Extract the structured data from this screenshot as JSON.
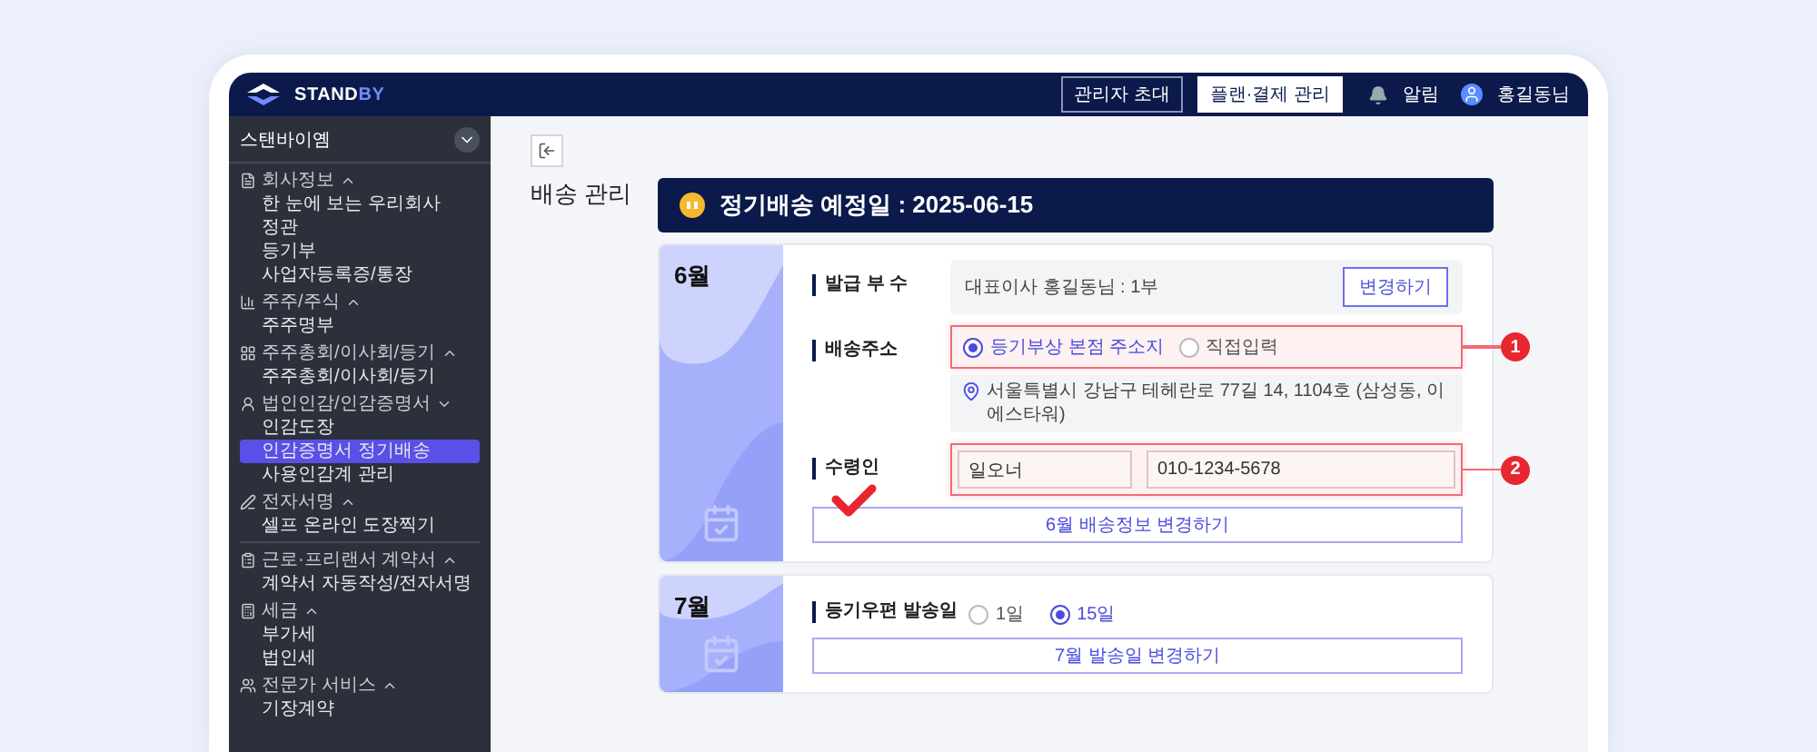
{
  "header": {
    "logo": {
      "text": "STAND",
      "accent": "BY"
    },
    "buttons": [
      {
        "label": "관리자 초대",
        "kind": "outline"
      },
      {
        "label": "플랜·결제 관리",
        "kind": "solid"
      }
    ],
    "notifications": "알림",
    "user": "홍길동님"
  },
  "sidebar": {
    "company": "스탠바이옘",
    "groups": [
      {
        "title": "회사정보",
        "expanded": true,
        "divider_before": false,
        "items": [
          {
            "label": "한 눈에 보는 우리회사",
            "selected": false
          },
          {
            "label": "정관",
            "selected": false
          },
          {
            "label": "등기부",
            "selected": false
          },
          {
            "label": "사업자등록증/통장",
            "selected": false
          }
        ]
      },
      {
        "title": "주주/주식",
        "expanded": true,
        "divider_before": false,
        "items": [
          {
            "label": "주주명부",
            "selected": false
          }
        ]
      },
      {
        "title": "주주총회/이사회/등기",
        "expanded": true,
        "divider_before": false,
        "items": [
          {
            "label": "주주총회/이사회/등기",
            "selected": false
          }
        ]
      },
      {
        "title": "법인인감/인감증명서",
        "expanded": false,
        "divider_before": false,
        "items": [
          {
            "label": "인감도장",
            "selected": false
          },
          {
            "label": "인감증명서 정기배송",
            "selected": true
          },
          {
            "label": "사용인감계 관리",
            "selected": false
          }
        ]
      },
      {
        "title": "전자서명",
        "expanded": true,
        "divider_before": false,
        "items": [
          {
            "label": "셀프 온라인 도장찍기",
            "selected": false
          }
        ]
      },
      {
        "title": "근로·프리랜서 계약서",
        "expanded": true,
        "divider_before": true,
        "items": [
          {
            "label": "계약서 자동작성/전자서명",
            "selected": false
          }
        ]
      },
      {
        "title": "세금",
        "expanded": true,
        "divider_before": false,
        "items": [
          {
            "label": "부가세",
            "selected": false
          },
          {
            "label": "법인세",
            "selected": false
          }
        ]
      },
      {
        "title": "전문가 서비스",
        "expanded": true,
        "divider_before": false,
        "items": [
          {
            "label": "기장계약",
            "selected": false
          }
        ]
      }
    ]
  },
  "page": {
    "title": "배송 관리"
  },
  "banner": {
    "text": "정기배송 예정일 : 2025-06-15"
  },
  "months": [
    {
      "kind": "full",
      "month": "6월",
      "checked": true,
      "copies": {
        "label": "발급 부 수",
        "value": "대표이사 홍길동님 : 1부",
        "button": "변경하기"
      },
      "address": {
        "label": "배송주소",
        "marker": "1",
        "options": [
          {
            "label": "등기부상 본점 주소지",
            "selected": true
          },
          {
            "label": "직접입력",
            "selected": false
          }
        ],
        "value": "서울특별시 강남구 테헤란로 77길 14, 1104호 (삼성동, 이에스타워)"
      },
      "recipient": {
        "label": "수령인",
        "marker": "2",
        "name": "일오너",
        "phone": "010-1234-5678"
      },
      "action": "6월 배송정보 변경하기"
    },
    {
      "kind": "date",
      "month": "7월",
      "checked": false,
      "label": "등기우편 발송일",
      "options": [
        {
          "label": "1일",
          "selected": false
        },
        {
          "label": "15일",
          "selected": true
        }
      ],
      "action": "7월 발송일 변경하기"
    }
  ]
}
